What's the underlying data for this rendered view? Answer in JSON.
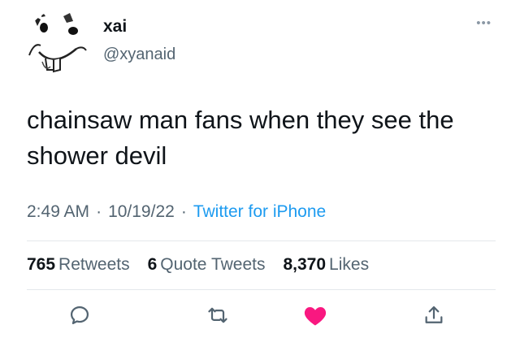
{
  "author": {
    "display_name": "xai",
    "handle": "@xyanaid",
    "avatar_icon": "smiling-face-sketch-avatar"
  },
  "more_icon": "more-dots-icon",
  "tweet": {
    "text": "chainsaw man fans when they see the shower devil",
    "time": "2:49 AM",
    "separator": "·",
    "date": "10/19/22",
    "source": "Twitter for iPhone"
  },
  "stats": {
    "retweets_count": "765",
    "retweets_label": "Retweets",
    "quotes_count": "6",
    "quotes_label": "Quote Tweets",
    "likes_count": "8,370",
    "likes_label": "Likes"
  },
  "actions": {
    "reply_icon": "reply-icon",
    "retweet_icon": "retweet-icon",
    "like_icon": "heart-icon",
    "share_icon": "share-icon"
  },
  "colors": {
    "text": "#0f1419",
    "secondary": "#536471",
    "link": "#1d9bf0",
    "like": "#f91880",
    "divider": "#e4e8eb"
  }
}
